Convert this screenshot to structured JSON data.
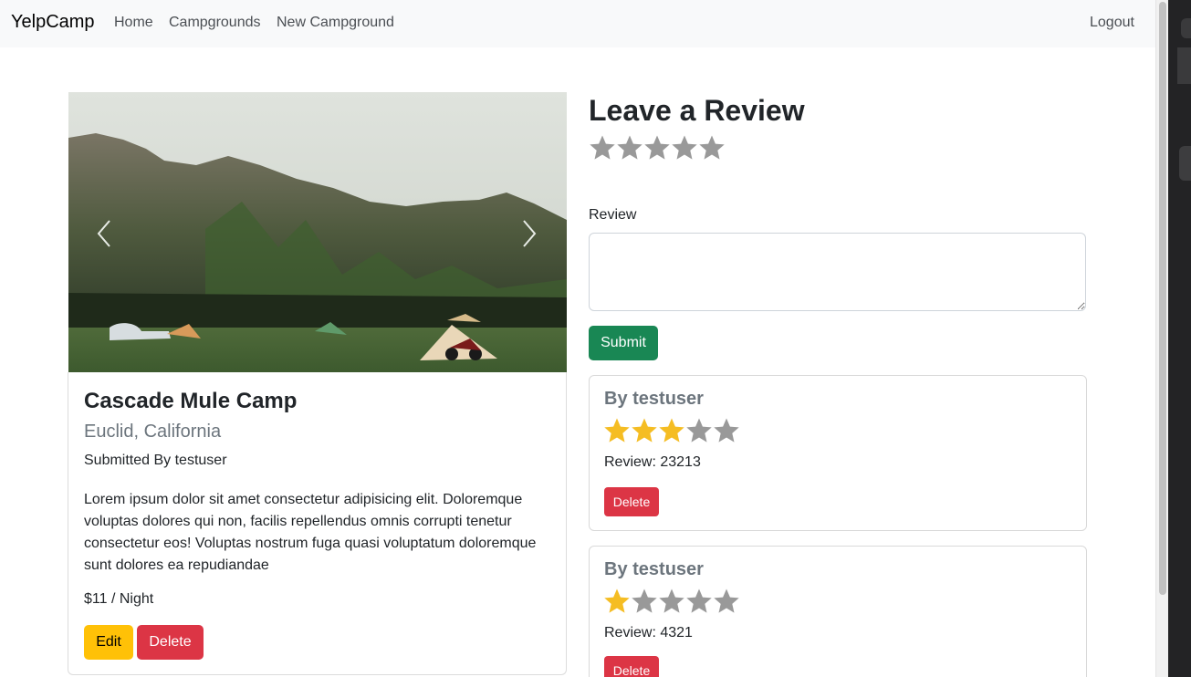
{
  "navbar": {
    "brand": "YelpCamp",
    "links": [
      "Home",
      "Campgrounds",
      "New Campground"
    ],
    "logout": "Logout"
  },
  "campground": {
    "title": "Cascade Mule Camp",
    "location": "Euclid, California",
    "submitted_by": "Submitted By testuser",
    "description": "Lorem ipsum dolor sit amet consectetur adipisicing elit. Doloremque voluptas dolores qui non, facilis repellendus omnis corrupti tenetur consectetur eos! Voluptas nostrum fuga quasi voluptatum doloremque sunt dolores ea repudiandae",
    "price": "$11 / Night",
    "edit_label": "Edit",
    "delete_label": "Delete"
  },
  "review_form": {
    "heading": "Leave a Review",
    "rating": 0,
    "max_rating": 5,
    "label": "Review",
    "value": "",
    "submit_label": "Submit"
  },
  "reviews": [
    {
      "author": "By testuser",
      "rating": 3,
      "text": "Review: 23213",
      "delete_label": "Delete"
    },
    {
      "author": "By testuser",
      "rating": 1,
      "text": "Review: 4321",
      "delete_label": "Delete"
    }
  ],
  "colors": {
    "star_filled": "#f5bd23",
    "star_empty": "#999999",
    "edit": "#ffc107",
    "danger": "#dc3545",
    "success": "#198754"
  }
}
